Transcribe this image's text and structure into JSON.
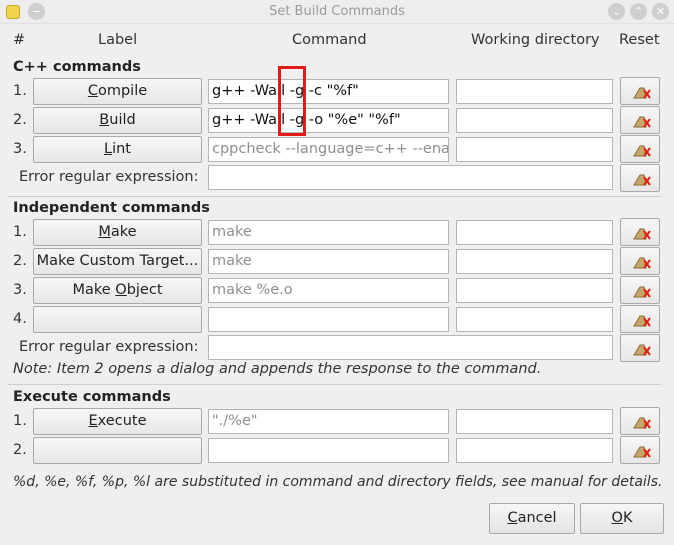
{
  "window": {
    "title": "Set Build Commands"
  },
  "headers": {
    "num": "#",
    "label": "Label",
    "command": "Command",
    "workdir": "Working directory",
    "reset": "Reset"
  },
  "cpp": {
    "title": "C++ commands",
    "rows": [
      {
        "num": "1.",
        "label_ul": "C",
        "label_rest": "ompile",
        "command": "g++ -Wall -g -c \"%f\""
      },
      {
        "num": "2.",
        "label_ul": "B",
        "label_rest": "uild",
        "command": "g++ -Wall -g -o \"%e\" \"%f\""
      },
      {
        "num": "3.",
        "label_ul": "L",
        "label_rest": "int",
        "command": "cppcheck --language=c++ --enab"
      }
    ],
    "error_label": "Error regular expression:"
  },
  "independent": {
    "title": "Independent commands",
    "rows": [
      {
        "num": "1.",
        "label_ul": "M",
        "label_rest": "ake",
        "command": "make"
      },
      {
        "num": "2.",
        "label": "Make Custom Target...",
        "command": "make"
      },
      {
        "num": "3.",
        "label_pre": "Make ",
        "label_ul": "O",
        "label_rest": "bject",
        "command": "make %e.o"
      },
      {
        "num": "4.",
        "label": "",
        "command": ""
      }
    ],
    "error_label": "Error regular expression:",
    "note": "Note: Item 2 opens a dialog and appends the response to the command."
  },
  "execute": {
    "title": "Execute commands",
    "rows": [
      {
        "num": "1.",
        "label_ul": "E",
        "label_rest": "xecute",
        "command": "\"./%e\""
      },
      {
        "num": "2.",
        "label": "",
        "command": ""
      }
    ]
  },
  "footer_note": "%d, %e, %f, %p, %l are substituted in command and directory fields, see manual for details.",
  "buttons": {
    "cancel_ul": "C",
    "cancel_rest": "ancel",
    "ok_ul": "O",
    "ok_rest": "K"
  },
  "icons": {
    "reset": "clear-broom-icon",
    "app": "geany-app-icon"
  },
  "colors": {
    "highlight": "#e11a1a"
  }
}
